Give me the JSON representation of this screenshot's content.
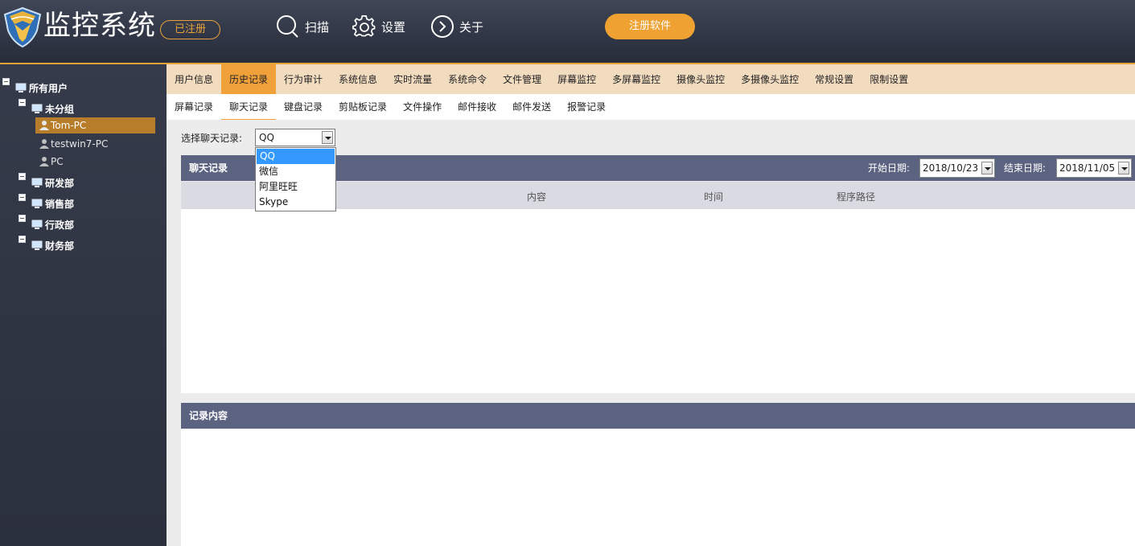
{
  "header": {
    "title": "监控系统",
    "registered_badge": "已注册",
    "nav": [
      {
        "label": "扫描",
        "icon": "search-icon"
      },
      {
        "label": "设置",
        "icon": "gear-icon"
      },
      {
        "label": "关于",
        "icon": "chevron-right-circle-icon"
      }
    ],
    "register_button": "注册软件",
    "accent_color": "#efa132"
  },
  "sidebar": {
    "root": "所有用户",
    "groups": [
      {
        "label": "未分组",
        "users": [
          "Tom-PC",
          "testwin7-PC",
          "PC"
        ]
      },
      {
        "label": "研发部"
      },
      {
        "label": "销售部"
      },
      {
        "label": "行政部"
      },
      {
        "label": "财务部"
      }
    ],
    "selected_user": "Tom-PC"
  },
  "main_tabs": [
    "用户信息",
    "历史记录",
    "行为审计",
    "系统信息",
    "实时流量",
    "系统命令",
    "文件管理",
    "屏幕监控",
    "多屏幕监控",
    "摄像头监控",
    "多摄像头监控",
    "常规设置",
    "限制设置"
  ],
  "main_tab_active": "历史记录",
  "sub_tabs": [
    "屏幕记录",
    "聊天记录",
    "键盘记录",
    "剪贴板记录",
    "文件操作",
    "邮件接收",
    "邮件发送",
    "报警记录"
  ],
  "sub_tab_active": "聊天记录",
  "chat_select": {
    "label": "选择聊天记录:",
    "value": "QQ",
    "options": [
      "QQ",
      "微信",
      "阿里旺旺",
      "Skype"
    ],
    "highlighted": "QQ"
  },
  "chat_panel": {
    "title": "聊天记录",
    "start_label": "开始日期:",
    "start_date": "2018/10/23",
    "end_label": "结束日期:",
    "end_date": "2018/11/05",
    "columns": [
      "内容",
      "时间",
      "程序路径"
    ]
  },
  "detail_panel": {
    "title": "记录内容"
  }
}
